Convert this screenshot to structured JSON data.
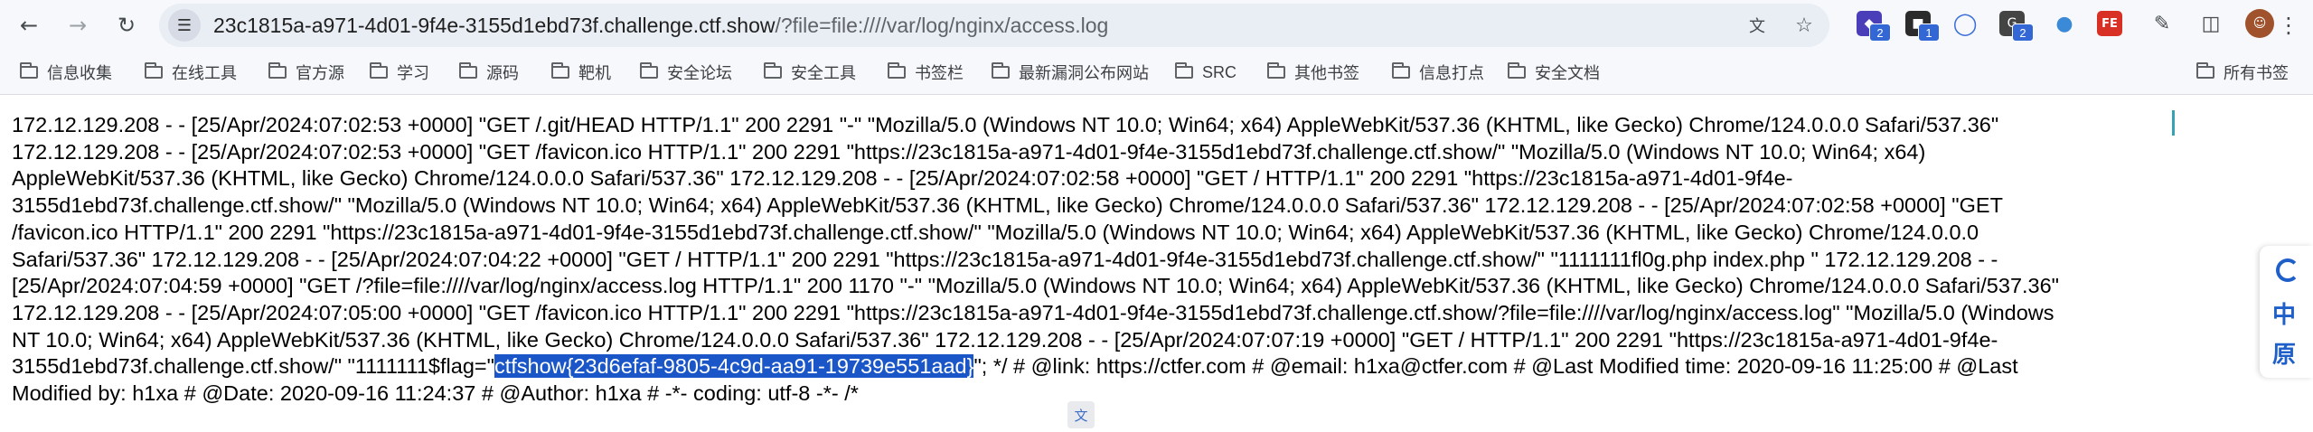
{
  "browser": {
    "url_host": "23c1815a-a971-4d01-9f4e-3155d1ebd73f.challenge.ctf.show",
    "url_path": "/?file=file:////var/log/nginx/access.log",
    "extensions": [
      {
        "name": "extension-1",
        "badge": "2",
        "color": "#4a3fb8"
      },
      {
        "name": "extension-2",
        "badge": "1",
        "color": "#2b2b2b"
      },
      {
        "name": "extension-3",
        "badge": "",
        "color": "#3b6fd8"
      },
      {
        "name": "extension-4",
        "badge": "2",
        "color": "#444444"
      },
      {
        "name": "extension-5",
        "badge": "",
        "color": "#3a8ad8"
      },
      {
        "name": "extension-6",
        "badge": "",
        "color": "#d93025",
        "label": "FE"
      }
    ]
  },
  "bookmarks": [
    "信息收集",
    "在线工具",
    "官方源",
    "学习",
    "源码",
    "靶机",
    "安全论坛",
    "安全工具",
    "书签栏",
    "最新漏洞公布网站",
    "SRC",
    "其他书签",
    "信息打点",
    "安全文档"
  ],
  "all_bookmarks_label": "所有书签",
  "log_lines": [
    "172.12.129.208 - - [25/Apr/2024:07:02:53 +0000] \"GET /.git/HEAD HTTP/1.1\" 200 2291 \"-\" \"Mozilla/5.0 (Windows NT 10.0; Win64; x64) AppleWebKit/537.36 (KHTML, like Gecko) Chrome/124.0.0.0 Safari/537.36\"",
    "172.12.129.208 - - [25/Apr/2024:07:02:53 +0000] \"GET /favicon.ico HTTP/1.1\" 200 2291 \"https://23c1815a-a971-4d01-9f4e-3155d1ebd73f.challenge.ctf.show/\" \"Mozilla/5.0 (Windows NT 10.0; Win64; x64)",
    "AppleWebKit/537.36 (KHTML, like Gecko) Chrome/124.0.0.0 Safari/537.36\" 172.12.129.208 - - [25/Apr/2024:07:02:58 +0000] \"GET / HTTP/1.1\" 200 2291 \"https://23c1815a-a971-4d01-9f4e-",
    "3155d1ebd73f.challenge.ctf.show/\" \"Mozilla/5.0 (Windows NT 10.0; Win64; x64) AppleWebKit/537.36 (KHTML, like Gecko) Chrome/124.0.0.0 Safari/537.36\" 172.12.129.208 - - [25/Apr/2024:07:02:58 +0000] \"GET",
    "/favicon.ico HTTP/1.1\" 200 2291 \"https://23c1815a-a971-4d01-9f4e-3155d1ebd73f.challenge.ctf.show/\" \"Mozilla/5.0 (Windows NT 10.0; Win64; x64) AppleWebKit/537.36 (KHTML, like Gecko) Chrome/124.0.0.0",
    "Safari/537.36\" 172.12.129.208 - - [25/Apr/2024:07:04:22 +0000] \"GET / HTTP/1.1\" 200 2291 \"https://23c1815a-a971-4d01-9f4e-3155d1ebd73f.challenge.ctf.show/\" \"1111111fl0g.php index.php \" 172.12.129.208 - -",
    "[25/Apr/2024:07:04:59 +0000] \"GET /?file=file:////var/log/nginx/access.log HTTP/1.1\" 200 1170 \"-\" \"Mozilla/5.0 (Windows NT 10.0; Win64; x64) AppleWebKit/537.36 (KHTML, like Gecko) Chrome/124.0.0.0 Safari/537.36\"",
    "172.12.129.208 - - [25/Apr/2024:07:05:00 +0000] \"GET /favicon.ico HTTP/1.1\" 200 2291 \"https://23c1815a-a971-4d01-9f4e-3155d1ebd73f.challenge.ctf.show/?file=file:////var/log/nginx/access.log\" \"Mozilla/5.0 (Windows",
    "NT 10.0; Win64; x64) AppleWebKit/537.36 (KHTML, like Gecko) Chrome/124.0.0.0 Safari/537.36\" 172.12.129.208 - - [25/Apr/2024:07:07:19 +0000] \"GET / HTTP/1.1\" 200 2291 \"https://23c1815a-a971-4d01-9f4e-"
  ],
  "flag_line": {
    "before": "3155d1ebd73f.challenge.ctf.show/\" \"1111111$flag=\"",
    "selected": "ctfshow{23d6efaf-9805-4c9d-aa91-19739e551aad}",
    "after": "\"; */ # @link: https://ctfer.com # @email: h1xa@ctfer.com # @Last Modified time: 2020-09-16 11:25:00 # @Last"
  },
  "last_line": "Modified by: h1xa # @Date: 2020-09-16 11:24:37 # @Author: h1xa # -*- coding: utf-8 -*- /*",
  "side_panel": {
    "char_1": "中",
    "char_2": "原"
  }
}
